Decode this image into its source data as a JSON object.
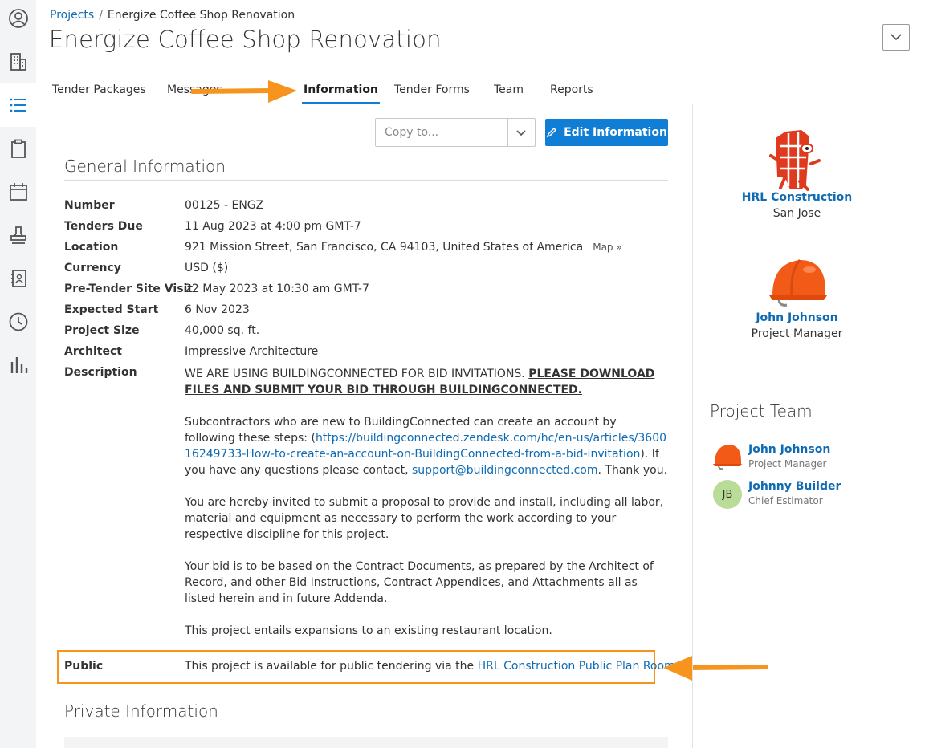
{
  "breadcrumb": {
    "root": "Projects",
    "separator": "/",
    "current": "Energize Coffee Shop Renovation"
  },
  "page": {
    "title": "Energize Coffee Shop Renovation"
  },
  "tabs": [
    {
      "label": "Tender Packages"
    },
    {
      "label": "Messages"
    },
    {
      "label": "Information",
      "active": true
    },
    {
      "label": "Tender Forms"
    },
    {
      "label": "Team"
    },
    {
      "label": "Reports"
    }
  ],
  "toolbar": {
    "copy_placeholder": "Copy to...",
    "edit_label": "Edit Information"
  },
  "general": {
    "title": "General Information",
    "rows": [
      {
        "label": "Number",
        "value": "00125 - ENGZ"
      },
      {
        "label": "Tenders Due",
        "value": "11 Aug 2023 at 4:00 pm GMT-7"
      },
      {
        "label": "Location",
        "value": "921 Mission Street, San Francisco, CA 94103, United States of America",
        "extra": "Map »"
      },
      {
        "label": "Currency",
        "value": "USD ($)"
      },
      {
        "label": "Pre-Tender Site Visit",
        "value": "22 May 2023 at 10:30 am GMT-7"
      },
      {
        "label": "Expected Start",
        "value": "6 Nov 2023"
      },
      {
        "label": "Project Size",
        "value": "40,000 sq. ft."
      },
      {
        "label": "Architect",
        "value": "Impressive Architecture"
      },
      {
        "label": "Description"
      }
    ],
    "description": {
      "p1_plain": "WE ARE USING BUILDINGCONNECTED FOR BID INVITATIONS. ",
      "p1_emph": "PLEASE DOWNLOAD FILES AND SUBMIT YOUR BID THROUGH BUILDINGCONNECTED.",
      "p2_a": "Subcontractors who are new to BuildingConnected can create an account by following these steps: (",
      "p2_link": "https://buildingconnected.zendesk.com/hc/en-us/articles/360016249733-How-to-create-an-account-on-BuildingConnected-from-a-bid-invitation",
      "p2_b": "). If you have any questions please contact, ",
      "p2_email": "support@buildingconnected.com",
      "p2_c": ". Thank you.",
      "p3": "You are hereby invited to submit a proposal to provide and install, including all labor, material and equipment as necessary to perform the work according to your respective discipline for this project.",
      "p4": "Your bid is to be based on the Contract Documents, as prepared by the Architect of Record, and other Bid Instructions, Contract Appendices, and Attachments all as listed herein and in future Addenda.",
      "p5": "This project entails expansions to an existing restaurant location."
    },
    "public": {
      "label": "Public",
      "text": "This project is available for public tendering via the ",
      "link": "HRL Construction Public Plan Room"
    }
  },
  "private": {
    "title": "Private Information"
  },
  "company": {
    "name": "HRL Construction",
    "city": "San Jose"
  },
  "manager": {
    "name": "John Johnson",
    "role": "Project Manager"
  },
  "team": {
    "title": "Project Team",
    "members": [
      {
        "name": "John Johnson",
        "role": "Project Manager"
      },
      {
        "name": "Johnny Builder",
        "role": "Chief Estimator",
        "initials": "JB"
      }
    ]
  },
  "colors": {
    "accent": "#0f7ed4",
    "link": "#0f6bb3",
    "highlight": "#f7941d",
    "avatar_jb": "#b9dc98"
  }
}
